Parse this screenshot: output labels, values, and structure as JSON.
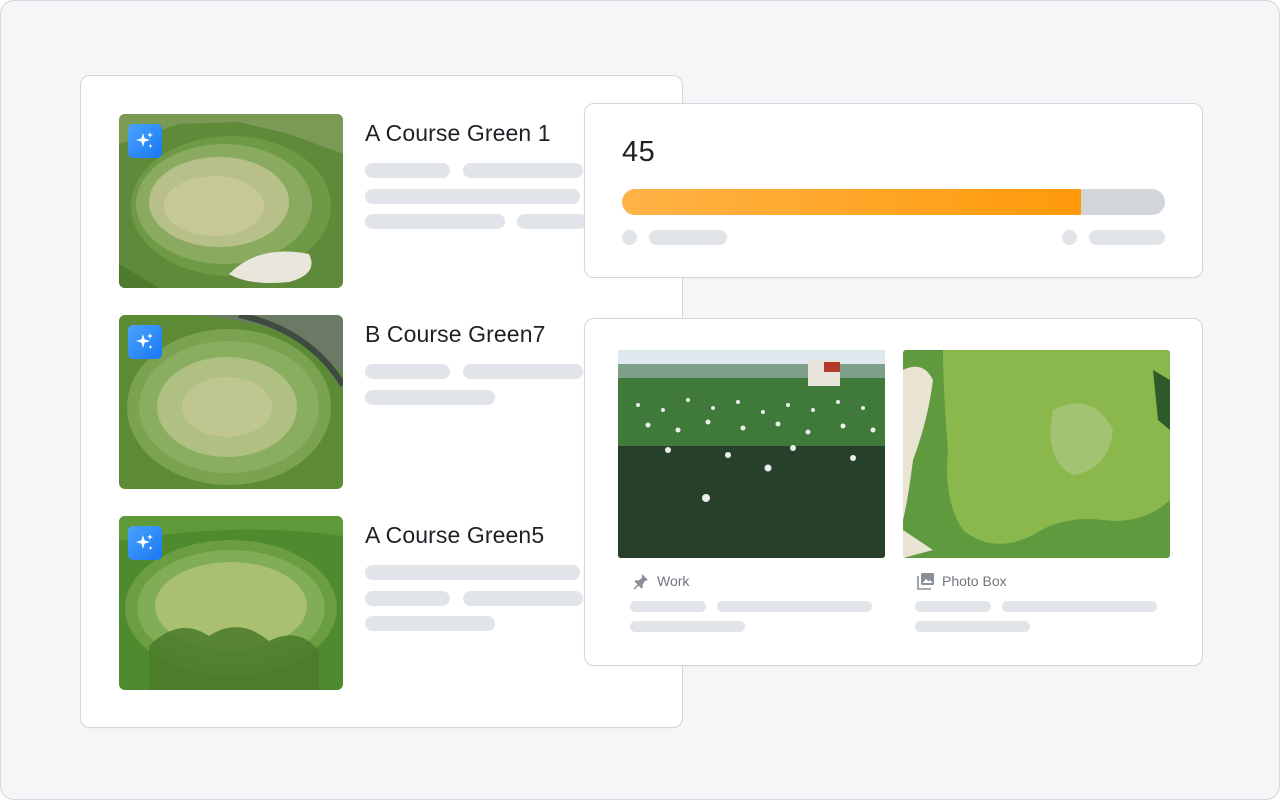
{
  "items": [
    {
      "title": "A Course Green 1",
      "badge_icon": "sparkles-icon"
    },
    {
      "title": "B Course Green7",
      "badge_icon": "sparkles-icon"
    },
    {
      "title": "A Course Green5",
      "badge_icon": "sparkles-icon"
    }
  ],
  "progress": {
    "value_text": "45",
    "fill_fraction": 0.845
  },
  "media": [
    {
      "label": "Work",
      "icon": "pin-icon"
    },
    {
      "label": "Photo Box",
      "icon": "photo-icon"
    }
  ],
  "colors": {
    "accent_orange": "#ff9a0a",
    "badge_blue": "#1877f2",
    "skeleton": "#e1e4e8"
  }
}
